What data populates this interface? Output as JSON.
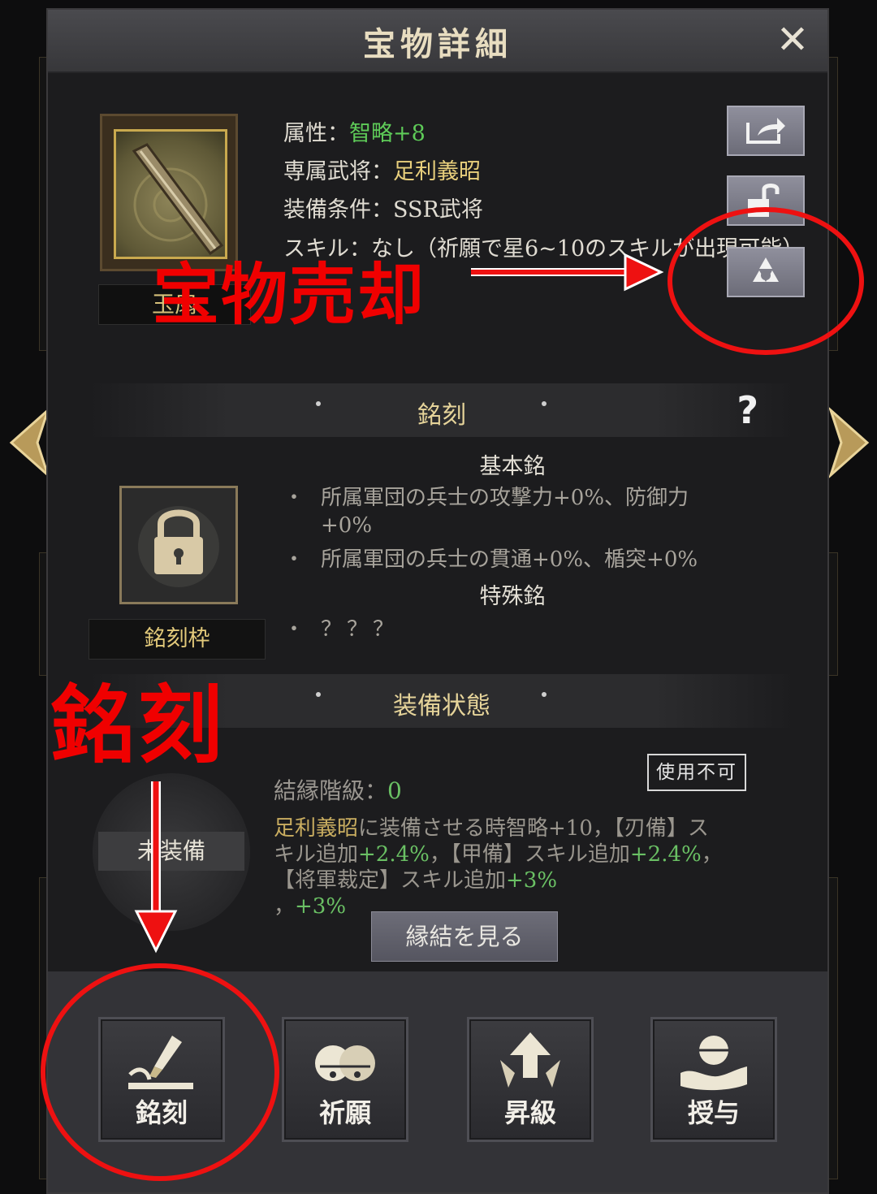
{
  "header": {
    "title": "宝物詳細"
  },
  "item": {
    "name": "玉扇",
    "attribute_label": "属性：",
    "attribute_value": "智略+8",
    "exclusive_label": "専属武将：",
    "exclusive_value": "足利義昭",
    "condition_label": "装備条件：",
    "condition_value": "SSR武将",
    "skill_text": "スキル：なし（祈願で星6~10のスキルが出現可能）"
  },
  "side_buttons": {
    "share": "share-icon",
    "unlock": "unlock-icon",
    "sell": "recycle-icon"
  },
  "engrave": {
    "section_title": "銘刻",
    "help": "?",
    "basic_head": "基本銘",
    "basic_lines": [
      "所属軍団の兵士の攻撃力+0%、防御力+0%",
      "所属軍団の兵士の貫通+0%、楯突+0%"
    ],
    "special_head": "特殊銘",
    "special_line": "？？？",
    "slot_label": "銘刻枠"
  },
  "equip": {
    "section_title": "装備状態",
    "state": "未装備",
    "stamp": "使用不可",
    "bond_label": "結縁階級：",
    "bond_value": "0",
    "desc_name": "足利義昭",
    "desc_p1": "に装備させる時智略+10，【刃備】スキル追加",
    "desc_v1": "+2.4%",
    "desc_p2": "，【甲備】スキル追加",
    "desc_v2": "+2.4%",
    "desc_p3": "，【将軍裁定】スキル追加",
    "desc_v3": "+3%",
    "desc_p4": "，",
    "desc_v4": "+3%",
    "view_button": "縁結を見る"
  },
  "actions": [
    {
      "label": "銘刻",
      "icon": "brush-icon"
    },
    {
      "label": "祈願",
      "icon": "bells-icon"
    },
    {
      "label": "昇級",
      "icon": "upgrade-arrow-icon"
    },
    {
      "label": "授与",
      "icon": "hand-orb-icon"
    }
  ],
  "annotations": {
    "sell_label": "宝物売却",
    "engrave_label": "銘刻"
  },
  "colors": {
    "accent_red": "#ee1111",
    "gold": "#e8cf7c",
    "green": "#5ecb58"
  }
}
